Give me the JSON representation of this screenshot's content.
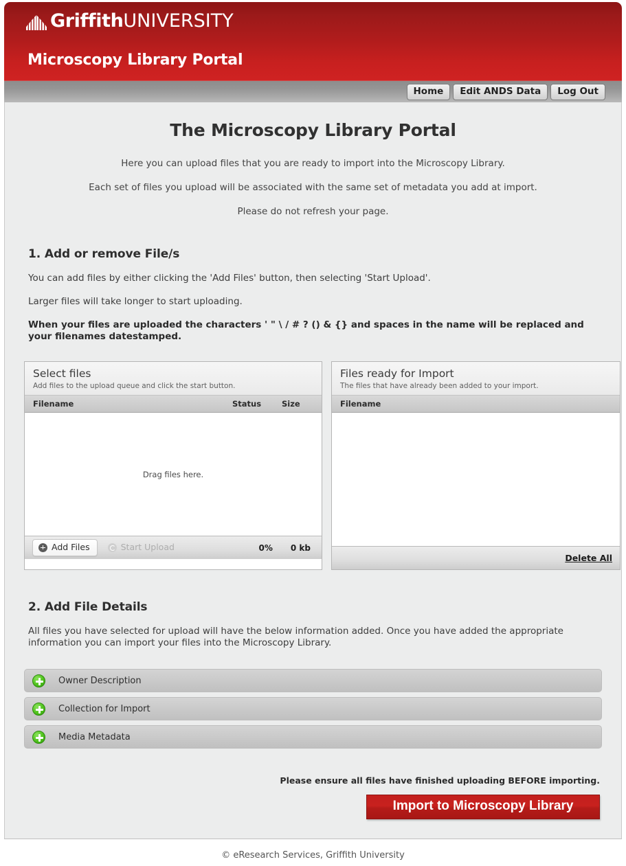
{
  "header": {
    "logo_bold": "Griffith",
    "logo_light": "UNIVERSITY",
    "logo_icon": "griffith-book-logo",
    "portal_title": "Microscopy Library Portal",
    "brand_red": "#b01c1c"
  },
  "nav": {
    "items": [
      {
        "label": "Home",
        "name": "nav-home"
      },
      {
        "label": "Edit ANDS Data",
        "name": "nav-edit-ands-data"
      },
      {
        "label": "Log Out",
        "name": "nav-log-out"
      }
    ]
  },
  "main": {
    "page_title": "The Microscopy Library Portal",
    "intro": [
      "Here you can upload files that you are ready to import into the Microscopy Library.",
      "Each set of files you upload will be associated with the same set of metadata you add at import.",
      "Please do not refresh your page."
    ]
  },
  "section1": {
    "heading": "1. Add or remove File/s",
    "p1": "You can add files by either clicking the 'Add Files' button, then selecting 'Start Upload'.",
    "p2": "Larger files will take longer to start uploading.",
    "p3": "When your files are uploaded the characters ' \" \\ / # ? () & {} and spaces in the name will be replaced and your filenames datestamped."
  },
  "select_files_panel": {
    "title": "Select files",
    "subtitle": "Add files to the upload queue and click the start button.",
    "columns": [
      "Filename",
      "Status",
      "Size"
    ],
    "rows": [],
    "drop_hint": "Drag files here.",
    "add_files_label": "Add Files",
    "start_upload_label": "Start Upload",
    "progress_percent": "0%",
    "total_size": "0 kb"
  },
  "ready_panel": {
    "title": "Files ready for Import",
    "subtitle": "The files that have already been added to your import.",
    "columns": [
      "Filename"
    ],
    "rows": [],
    "delete_all_label": "Delete All"
  },
  "section2": {
    "heading": "2. Add File Details",
    "p1": "All files you have selected for upload will have the below information added. Once you have added the appropriate information you can import your files into the Microscopy Library."
  },
  "accordion": {
    "items": [
      {
        "label": "Owner Description",
        "name": "accordion-owner-description",
        "icon": "plus-circle-green-icon"
      },
      {
        "label": "Collection for Import",
        "name": "accordion-collection-for-import",
        "icon": "plus-circle-green-icon"
      },
      {
        "label": "Media Metadata",
        "name": "accordion-media-metadata",
        "icon": "plus-circle-green-icon"
      }
    ]
  },
  "import": {
    "note": "Please ensure all files have finished uploading BEFORE importing.",
    "button_label": "Import to Microscopy Library",
    "button_color": "#c3201d"
  },
  "footer": {
    "text": "© eResearch Services, Griffith University"
  }
}
